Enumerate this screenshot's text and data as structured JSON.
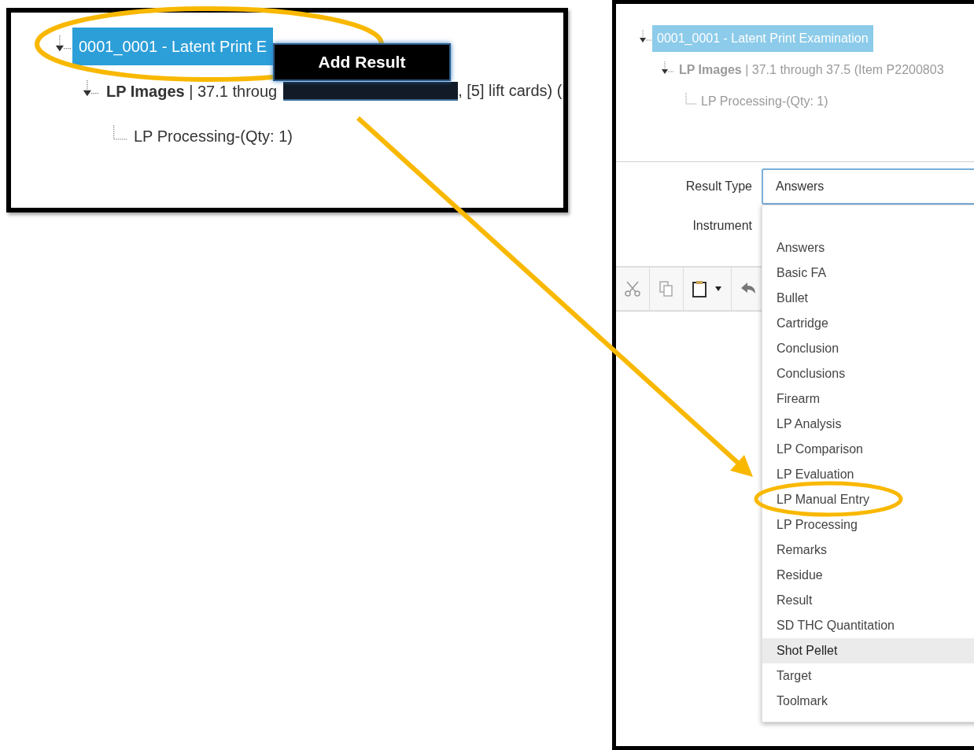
{
  "left_view": {
    "tree": [
      {
        "label": "0001_0001 - Latent Print E",
        "selected": true,
        "expanded": true,
        "children": [
          {
            "label": "**LP Images** | 37.1 throug",
            "label_after": ", [5] lift cards) (",
            "selected": false,
            "expanded": true,
            "children": [
              {
                "label": "LP Processing-(Qty: 1)",
                "selected": false
              }
            ]
          }
        ]
      }
    ],
    "context_menu": {
      "items": [
        "Add Result"
      ]
    }
  },
  "right_view": {
    "tree": [
      {
        "label": "0001_0001 - Latent Print Examination",
        "selected": true,
        "expanded": true,
        "children": [
          {
            "label": "**LP Images** | 37.1 through 37.5 (Item P2200803",
            "selected": false,
            "expanded": true,
            "children": [
              {
                "label": "LP Processing-(Qty: 1)",
                "selected": false
              }
            ]
          }
        ]
      }
    ],
    "form": {
      "fields": [
        {
          "label": "Result Type",
          "value": "Answers",
          "focused": true
        },
        {
          "label": "Instrument"
        }
      ]
    },
    "dropdown": {
      "options": [
        {
          "label": "Answers",
          "highlighted": false
        },
        {
          "label": "Basic FA",
          "highlighted": false
        },
        {
          "label": "Bullet",
          "highlighted": false
        },
        {
          "label": "Cartridge",
          "highlighted": false
        },
        {
          "label": "Conclusion",
          "highlighted": false
        },
        {
          "label": "Conclusions",
          "highlighted": false
        },
        {
          "label": "Firearm",
          "highlighted": false
        },
        {
          "label": "LP Analysis",
          "highlighted": false
        },
        {
          "label": "LP Comparison",
          "highlighted": false
        },
        {
          "label": "LP Evaluation",
          "highlighted": false
        },
        {
          "label": "LP Manual Entry",
          "highlighted": false
        },
        {
          "label": "LP Processing",
          "highlighted": false
        },
        {
          "label": "Remarks",
          "highlighted": false
        },
        {
          "label": "Residue",
          "highlighted": false
        },
        {
          "label": "Result",
          "highlighted": false
        },
        {
          "label": "SD THC Quantitation",
          "highlighted": false
        },
        {
          "label": "Shot Pellet",
          "highlighted": true
        },
        {
          "label": "Target",
          "highlighted": false
        },
        {
          "label": "Toolmark",
          "highlighted": false
        }
      ]
    }
  }
}
